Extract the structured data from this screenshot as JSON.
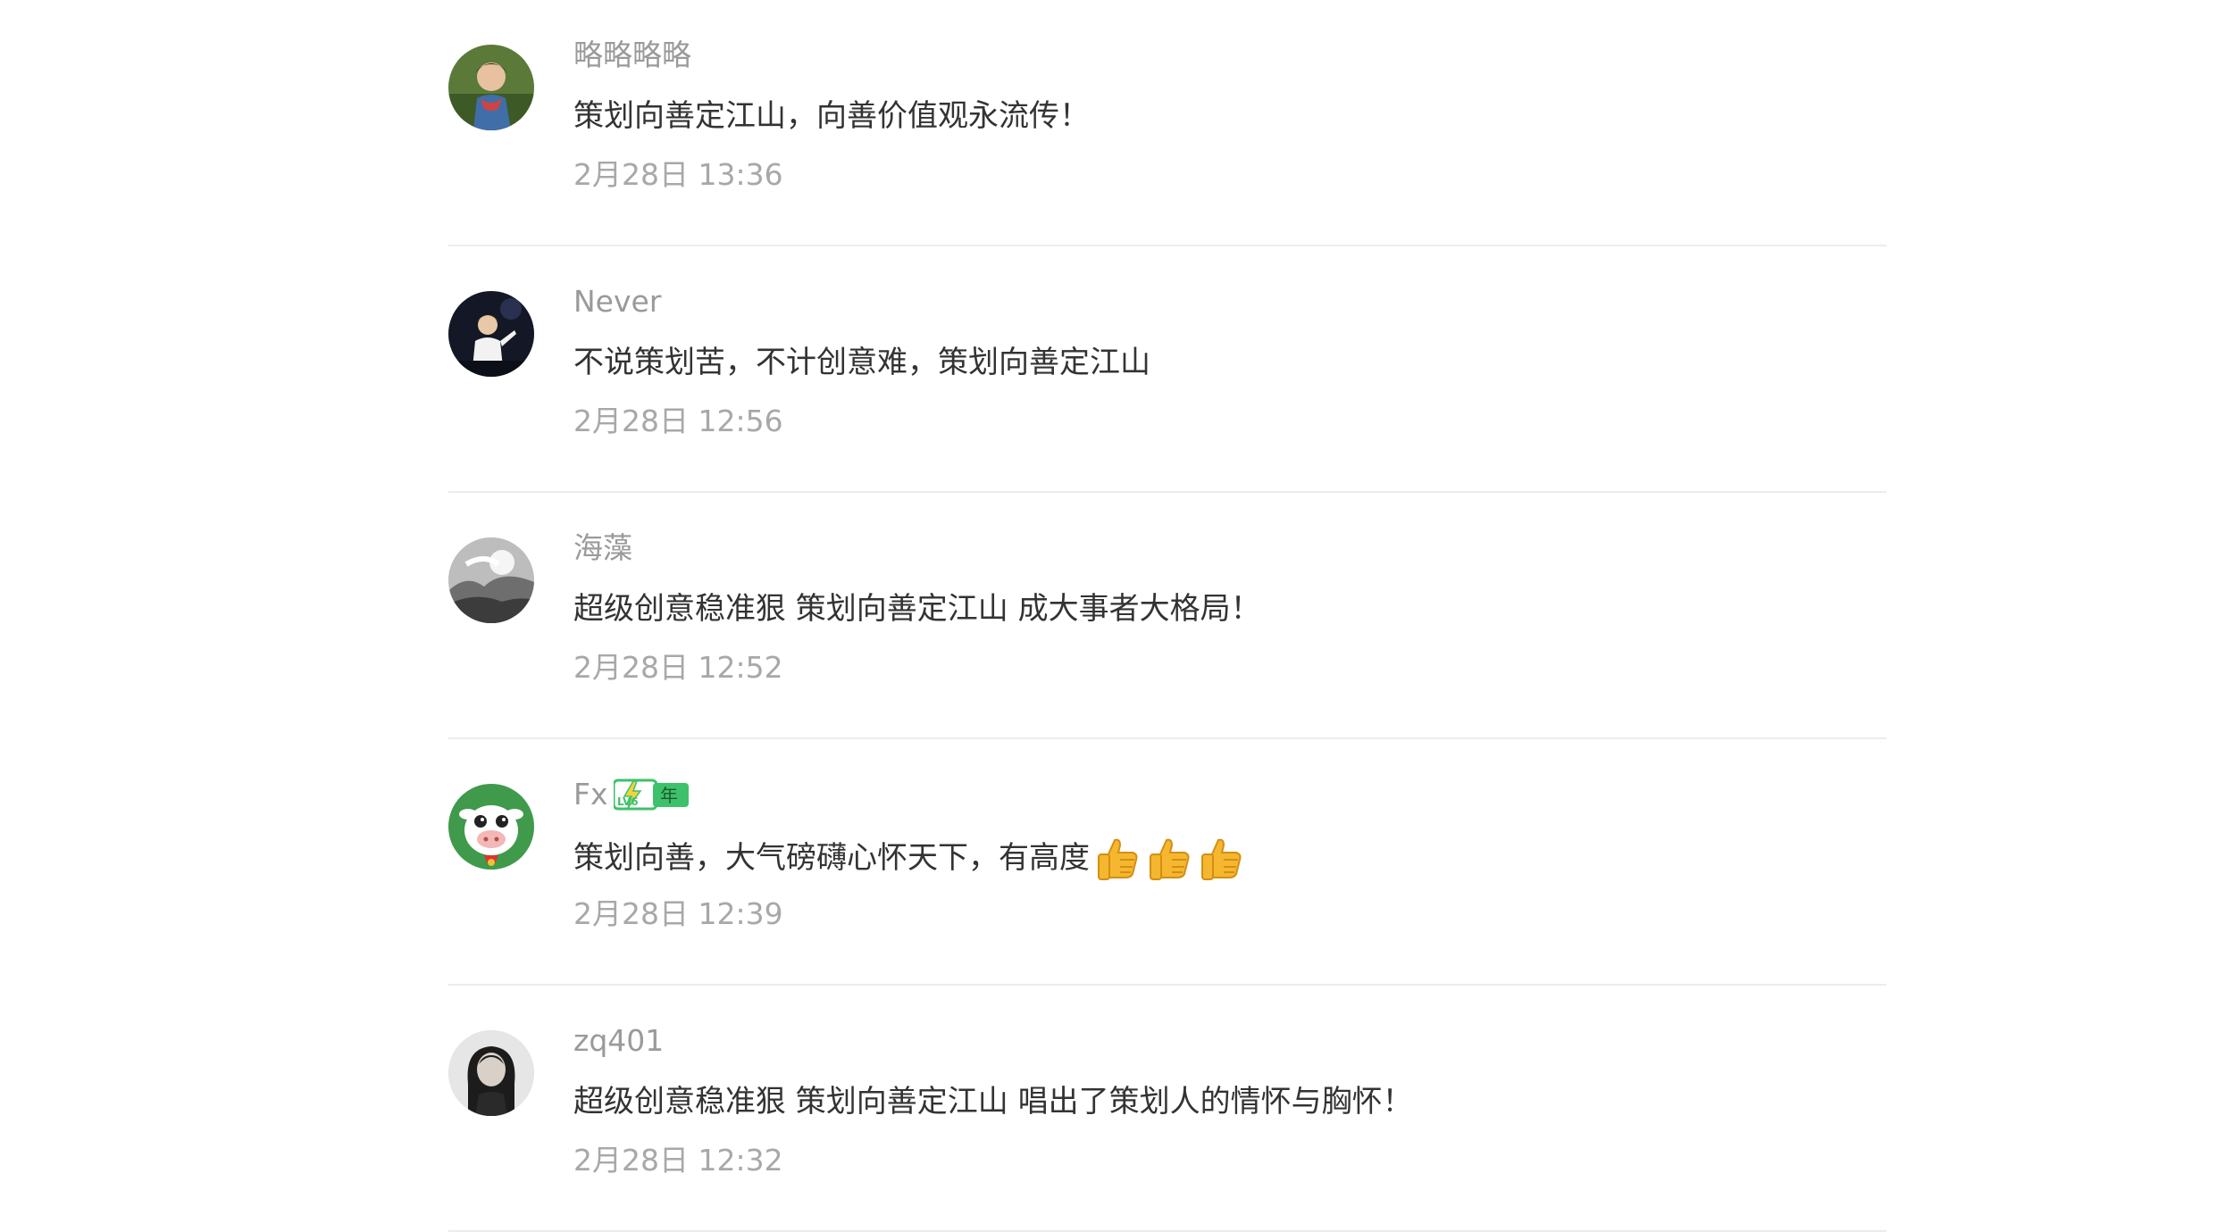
{
  "comments": [
    {
      "nickname": "略略略略",
      "content": "策划向善定江山，向善价值观永流传！",
      "time": "2月28日 13:36",
      "avatar_icon": "child-photo-avatar"
    },
    {
      "nickname": "Never",
      "content": "不说策划苦，不计创意难，策划向善定江山",
      "time": "2月28日 12:56",
      "avatar_icon": "stage-performer-avatar"
    },
    {
      "nickname": "海藻",
      "content": "超级创意稳准狠 策划向善定江山 成大事者大格局！",
      "time": "2月28日 12:52",
      "avatar_icon": "bw-landscape-avatar"
    },
    {
      "nickname": "Fx",
      "badge_level": "LV6",
      "badge_text": "年",
      "content": "策划向善，大气磅礴心怀天下，有高度",
      "emojis": [
        "thumbs-up-emoji",
        "thumbs-up-emoji",
        "thumbs-up-emoji"
      ],
      "time": "2月28日 12:39",
      "avatar_icon": "cartoon-cow-avatar"
    },
    {
      "nickname": "zq401",
      "content": "超级创意稳准狠 策划向善定江山 唱出了策划人的情怀与胸怀！",
      "time": "2月28日 12:32",
      "avatar_icon": "woman-portrait-avatar"
    }
  ],
  "colors": {
    "nickname": "#9a9a9a",
    "content": "#333333",
    "timestamp": "#a8a8a8",
    "divider": "#ececec",
    "badge_green": "#3dc26b"
  }
}
